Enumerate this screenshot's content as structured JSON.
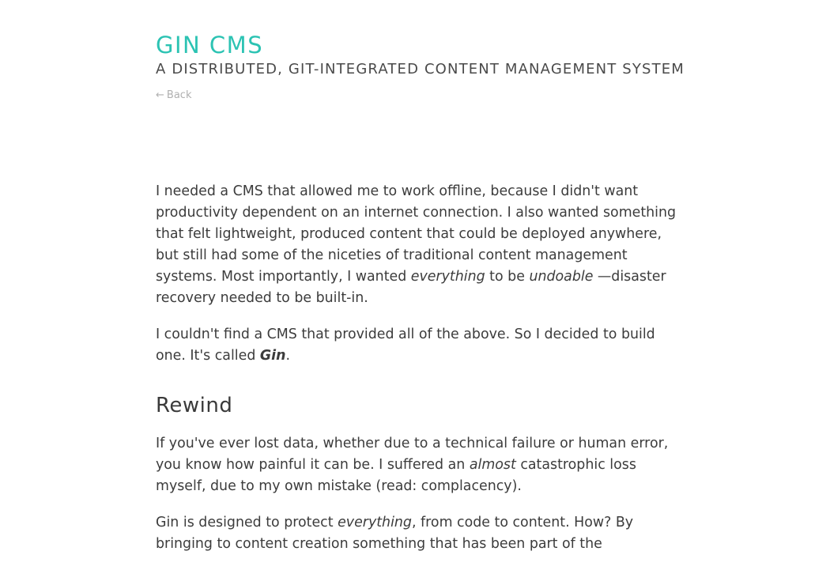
{
  "header": {
    "title": "GIN CMS",
    "subtitle": "A DISTRIBUTED, GIT-INTEGRATED CONTENT MANAGEMENT SYSTEM",
    "back_arrow": "←",
    "back_label": "Back"
  },
  "article": {
    "p1": {
      "a": "I needed a CMS that allowed me to work offline, because I didn't want productivity dependent on an internet connection. I also wanted something that felt lightweight, produced content that could be deployed anywhere, but still had some of the niceties of traditional content management systems. Most importantly, I wanted ",
      "em1": "everything",
      "b": " to be ",
      "em2": "undoable",
      "c": " —disaster recovery needed to be built-in."
    },
    "p2": {
      "a": "I couldn't find a CMS that provided all of the above. So I decided to build one. It's called ",
      "strong": "Gin",
      "b": "."
    },
    "h2": "Rewind",
    "p3": {
      "a": "If you've ever lost data, whether due to a technical failure or human error, you know how painful it can be. I suffered an ",
      "em": "almost",
      "b": " catastrophic loss myself, due to my own mistake (read: complacency)."
    },
    "p4": {
      "a": "Gin is designed to protect ",
      "em": "everything",
      "b": ", from code to content. How? By bringing to content creation something that has been part of the"
    }
  }
}
